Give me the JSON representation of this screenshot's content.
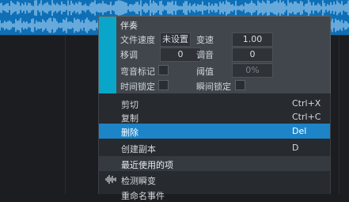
{
  "inspector": {
    "title": "伴奏",
    "rows": [
      {
        "label": "文件速度",
        "value": "未设置",
        "label2": "变速",
        "value2": "1.00"
      },
      {
        "label": "移调",
        "value": "0",
        "label2": "调音",
        "value2": "0"
      },
      {
        "label": "弯音标记",
        "label2": "阈值",
        "value2": "0%"
      },
      {
        "label": "时间锁定",
        "label2": "瞬间锁定"
      }
    ]
  },
  "menu": {
    "items": [
      {
        "label": "剪切",
        "shortcut": "Ctrl+X"
      },
      {
        "label": "复制",
        "shortcut": "Ctrl+C"
      },
      {
        "label": "删除",
        "shortcut": "Del",
        "active": true
      },
      {
        "label": "创建副本",
        "shortcut": "D"
      }
    ],
    "section_title": "最近使用的项",
    "recent": [
      {
        "label": "检测瞬变",
        "icon": "waveform-icon"
      },
      {
        "label": "重命名事件"
      }
    ]
  },
  "colors": {
    "accent": "#0aa6c9",
    "highlight": "#1e84c8",
    "waveform": "#0e6fb6"
  }
}
